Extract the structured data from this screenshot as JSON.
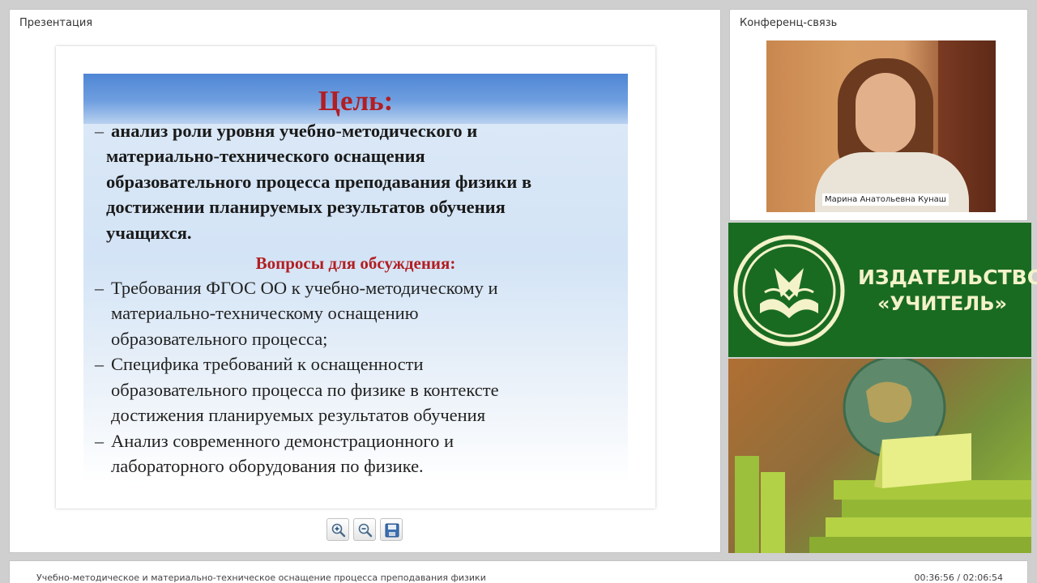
{
  "presentation_panel": {
    "title": "Презентация",
    "slide": {
      "goal_title": "Цель:",
      "goal_dash": "–",
      "goal_lines": [
        "анализ роли уровня учебно-методического и",
        "материально-технического оснащения",
        "образовательного процесса преподавания физики в",
        "достижении планируемых результатов обучения",
        "учащихся."
      ],
      "questions_title": "Вопросы для обсуждения:",
      "question_dash": "–",
      "question_lines": [
        "Требования ФГОС ОО к учебно-методическому  и",
        "материально-техническому  оснащению",
        "образовательного процесса;",
        "Специфика требований к оснащенности",
        "образовательного процесса по физике в контексте",
        "достижения планируемых результатов обучения",
        "Анализ современного демонстрационного и",
        "лабораторного оборудования  по физике."
      ]
    },
    "toolbar": {
      "zoom_in_icon": "zoom-in-icon",
      "zoom_out_icon": "zoom-out-icon",
      "save_icon": "floppy-disk-icon"
    }
  },
  "conference_panel": {
    "title": "Конференц-связь",
    "speaker_name": "Марина Анатольевна Кунаш"
  },
  "publisher_logo": {
    "line1": "ИЗДАТЕЛЬСТВО",
    "line2": "«УЧИТЕЛЬ»",
    "colors": {
      "background": "#1a6b22",
      "text": "#f3f2c9"
    }
  },
  "footer": {
    "title": "Учебно-методическое и материально-техническое оснащение процесса преподавания физики",
    "time": "00:36:56 / 02:06:54"
  }
}
